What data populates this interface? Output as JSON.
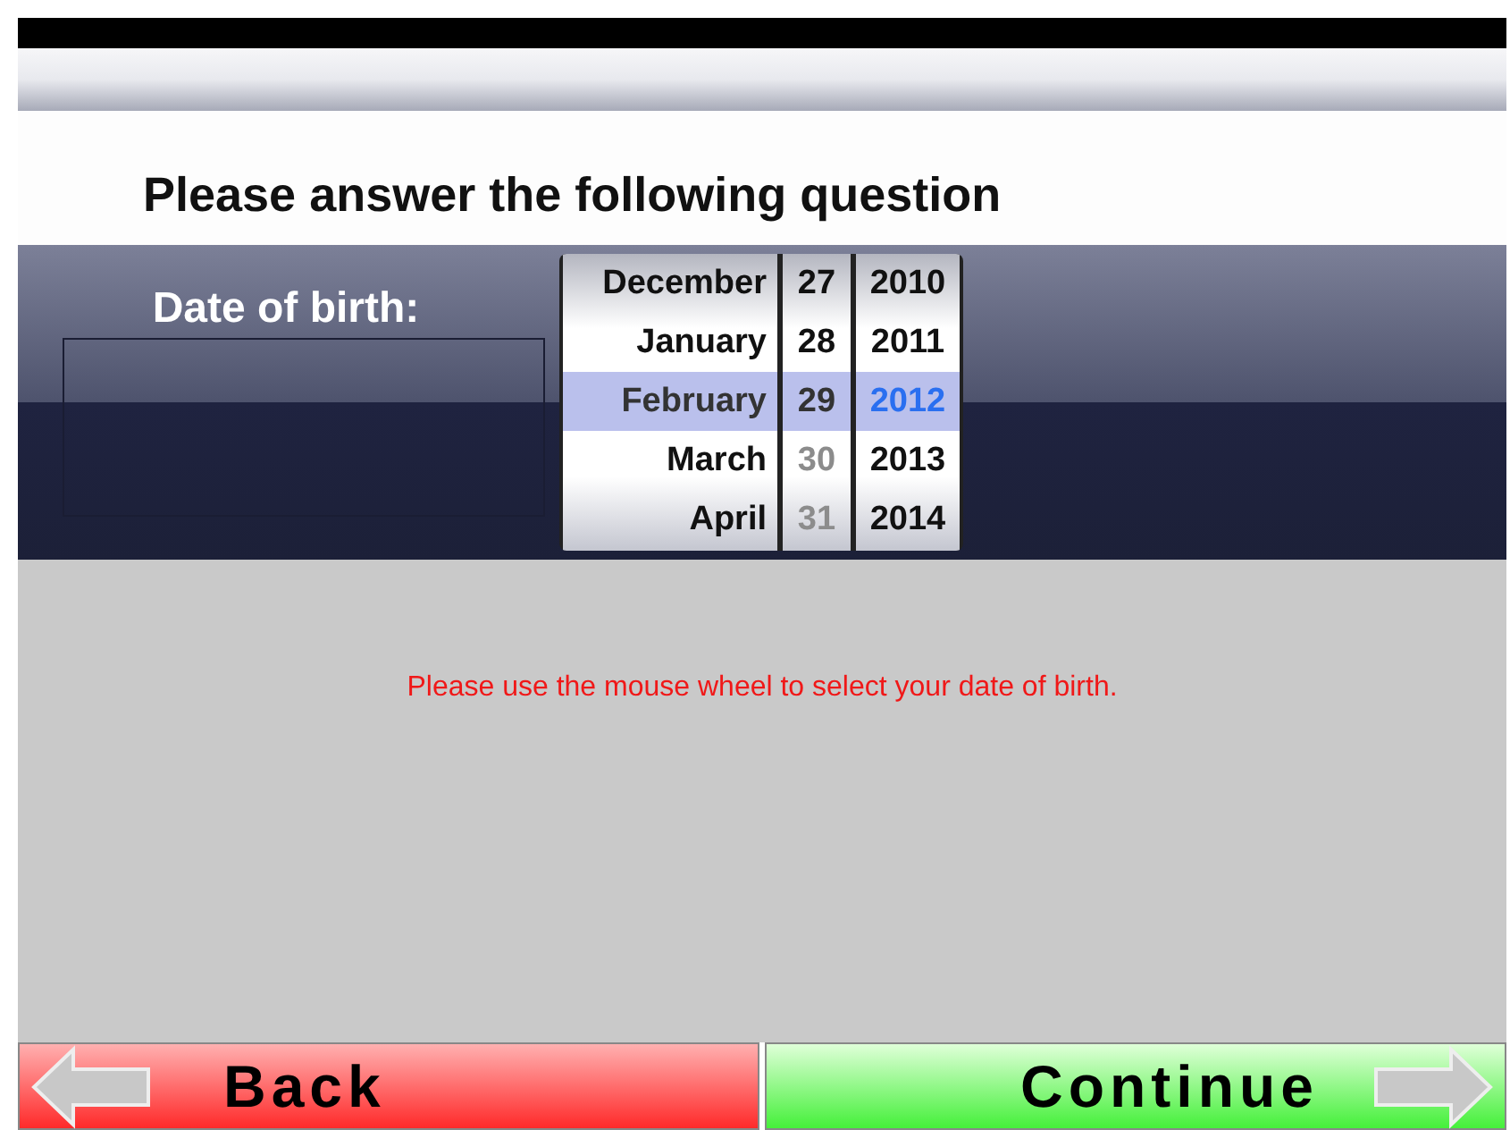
{
  "heading": "Please answer the following question",
  "field": {
    "label": "Date of birth:"
  },
  "picker": {
    "wheels": [
      {
        "kind": "month",
        "items": [
          {
            "text": "December",
            "selected": false,
            "disabled": false
          },
          {
            "text": "January",
            "selected": false,
            "disabled": false
          },
          {
            "text": "February",
            "selected": true,
            "disabled": false
          },
          {
            "text": "March",
            "selected": false,
            "disabled": false
          },
          {
            "text": "April",
            "selected": false,
            "disabled": false
          }
        ]
      },
      {
        "kind": "day",
        "items": [
          {
            "text": "27",
            "selected": false,
            "disabled": false
          },
          {
            "text": "28",
            "selected": false,
            "disabled": false
          },
          {
            "text": "29",
            "selected": true,
            "disabled": false
          },
          {
            "text": "30",
            "selected": false,
            "disabled": true
          },
          {
            "text": "31",
            "selected": false,
            "disabled": true
          }
        ]
      },
      {
        "kind": "year",
        "items": [
          {
            "text": "2010",
            "selected": false,
            "disabled": false
          },
          {
            "text": "2011",
            "selected": false,
            "disabled": false
          },
          {
            "text": "2012",
            "selected": true,
            "disabled": false
          },
          {
            "text": "2013",
            "selected": false,
            "disabled": false
          },
          {
            "text": "2014",
            "selected": false,
            "disabled": false
          }
        ]
      }
    ]
  },
  "message": "Please use the mouse wheel to select your date of birth.",
  "buttons": [
    {
      "kind": "back",
      "label": "Back"
    },
    {
      "kind": "continue",
      "label": "Continue"
    }
  ]
}
